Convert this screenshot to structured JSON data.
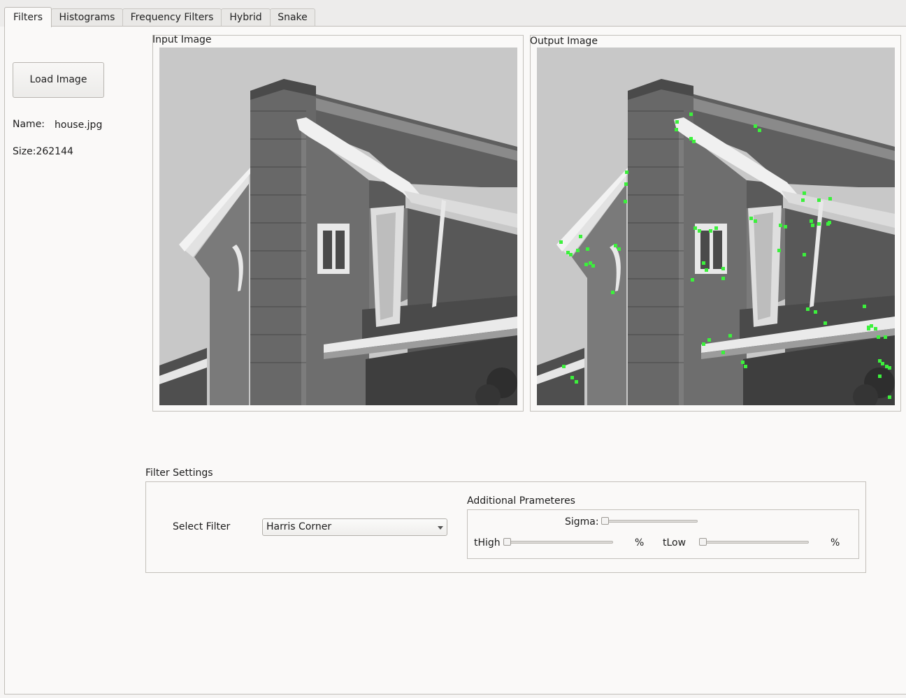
{
  "tabs": [
    {
      "label": "Filters",
      "active": true
    },
    {
      "label": "Histograms",
      "active": false
    },
    {
      "label": "Frequency Filters",
      "active": false
    },
    {
      "label": "Hybrid",
      "active": false
    },
    {
      "label": "Snake",
      "active": false
    }
  ],
  "load_button": {
    "label": "Load Image"
  },
  "file_info": {
    "name_label": "Name:",
    "name_value": "house.jpg",
    "size_text": "Size:262144"
  },
  "input_panel": {
    "title": "Input Image"
  },
  "output_panel": {
    "title": "Output Image",
    "corner_marker_color": "#3cf03c"
  },
  "filter_settings": {
    "title": "Filter Settings",
    "select_label": "Select Filter",
    "selected_filter": "Harris Corner"
  },
  "additional_params": {
    "title": "Additional Prameteres",
    "sigma_label": "Sigma:",
    "thigh_label": "tHigh",
    "thigh_unit": "%",
    "tlow_label": "tLow",
    "tlow_unit": "%"
  }
}
